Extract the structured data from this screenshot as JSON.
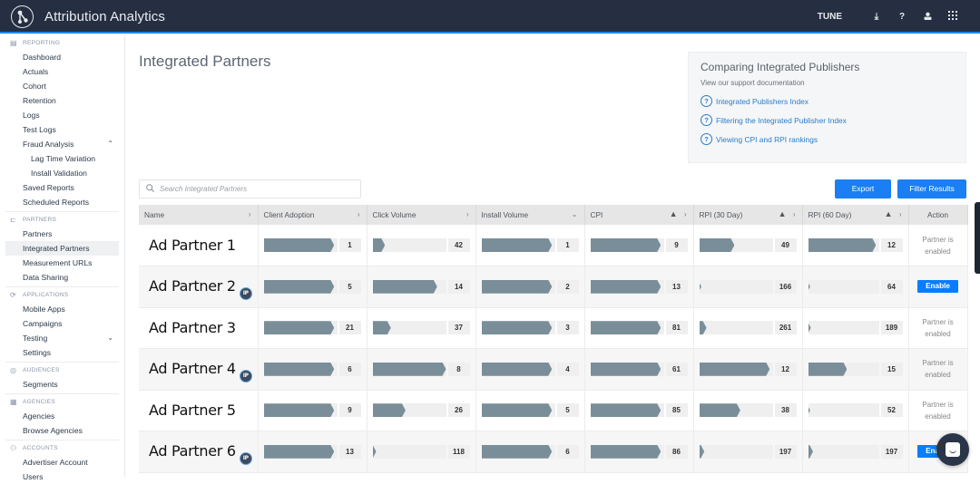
{
  "header": {
    "app_title": "Attribution Analytics",
    "account_label": "TUNE",
    "icons": [
      "download-icon",
      "help-icon",
      "user-icon",
      "apps-grid-icon"
    ]
  },
  "sidebar": {
    "sections": [
      {
        "label": "REPORTING",
        "icon": "bar-chart-icon",
        "items": [
          {
            "label": "Dashboard"
          },
          {
            "label": "Actuals"
          },
          {
            "label": "Cohort"
          },
          {
            "label": "Retention"
          },
          {
            "label": "Logs"
          },
          {
            "label": "Test Logs"
          },
          {
            "label": "Fraud Analysis",
            "expanded": true
          },
          {
            "label": "Lag Time Variation",
            "sub": true
          },
          {
            "label": "Install Validation",
            "sub": true
          },
          {
            "label": "Saved Reports"
          },
          {
            "label": "Scheduled Reports"
          }
        ]
      },
      {
        "label": "PARTNERS",
        "icon": "partners-icon",
        "items": [
          {
            "label": "Partners"
          },
          {
            "label": "Integrated Partners",
            "active": true
          },
          {
            "label": "Measurement URLs"
          },
          {
            "label": "Data Sharing"
          }
        ]
      },
      {
        "label": "APPLICATIONS",
        "icon": "applications-icon",
        "items": [
          {
            "label": "Mobile Apps"
          },
          {
            "label": "Campaigns"
          },
          {
            "label": "Testing",
            "collapsed": true
          },
          {
            "label": "Settings"
          }
        ]
      },
      {
        "label": "AUDIENCES",
        "icon": "audiences-icon",
        "items": [
          {
            "label": "Segments"
          }
        ]
      },
      {
        "label": "AGENCIES",
        "icon": "agencies-icon",
        "items": [
          {
            "label": "Agencies"
          },
          {
            "label": "Browse Agencies"
          }
        ]
      },
      {
        "label": "ACCOUNTS",
        "icon": "accounts-icon",
        "items": [
          {
            "label": "Advertiser Account"
          },
          {
            "label": "Users"
          }
        ]
      }
    ]
  },
  "main": {
    "page_title": "Integrated Partners",
    "help": {
      "title": "Comparing Integrated Publishers",
      "subtitle": "View our support documentation",
      "links": [
        "Integrated Publishers Index",
        "Filtering the Integrated Publisher Index",
        "Viewing CPI and RPI rankings"
      ]
    },
    "search_placeholder": "Search Integrated Partners",
    "export_label": "Export",
    "filter_label": "Filter Results",
    "table": {
      "columns": [
        {
          "label": "Name",
          "sort": "›"
        },
        {
          "label": "Client Adoption",
          "sort": "›"
        },
        {
          "label": "Click Volume",
          "sort": "›"
        },
        {
          "label": "Install Volume",
          "sort": "⌄"
        },
        {
          "label": "CPI",
          "sort": "›",
          "warning": true
        },
        {
          "label": "RPI (30 Day)",
          "sort": "›",
          "warning": true
        },
        {
          "label": "RPI (60 Day)",
          "sort": "›",
          "warning": true
        },
        {
          "label": "Action"
        }
      ],
      "rows": [
        {
          "name": "Ad Partner 1",
          "badge": false,
          "metrics": [
            {
              "rank": 1,
              "fill": 0.96
            },
            {
              "rank": 42,
              "fill": 0.17
            },
            {
              "rank": 1,
              "fill": 0.96
            },
            {
              "rank": 9,
              "fill": 0.96
            },
            {
              "rank": 49,
              "fill": 0.48
            },
            {
              "rank": 12,
              "fill": 0.96
            }
          ],
          "action": {
            "type": "text",
            "text": "Partner is enabled"
          }
        },
        {
          "name": "Ad Partner 2",
          "badge": true,
          "badge_label": "IP",
          "metrics": [
            {
              "rank": 5,
              "fill": 0.96
            },
            {
              "rank": 14,
              "fill": 0.88
            },
            {
              "rank": 2,
              "fill": 0.96
            },
            {
              "rank": 13,
              "fill": 0.96
            },
            {
              "rank": 166,
              "fill": 0.02
            },
            {
              "rank": 64,
              "fill": 0.02
            }
          ],
          "action": {
            "type": "button",
            "text": "Enable"
          }
        },
        {
          "name": "Ad Partner 3",
          "badge": false,
          "metrics": [
            {
              "rank": 21,
              "fill": 0.96
            },
            {
              "rank": 37,
              "fill": 0.25
            },
            {
              "rank": 3,
              "fill": 0.96
            },
            {
              "rank": 81,
              "fill": 0.96
            },
            {
              "rank": 261,
              "fill": 0.1
            },
            {
              "rank": 189,
              "fill": 0.04
            }
          ],
          "action": {
            "type": "text",
            "text": "Partner is enabled"
          }
        },
        {
          "name": "Ad Partner 4",
          "badge": true,
          "badge_label": "IP",
          "metrics": [
            {
              "rank": 6,
              "fill": 0.96
            },
            {
              "rank": 8,
              "fill": 1.0
            },
            {
              "rank": 4,
              "fill": 0.96
            },
            {
              "rank": 61,
              "fill": 0.96
            },
            {
              "rank": 12,
              "fill": 0.96
            },
            {
              "rank": 15,
              "fill": 0.55
            }
          ],
          "action": {
            "type": "text",
            "text": "Partner is enabled"
          }
        },
        {
          "name": "Ad Partner 5",
          "badge": false,
          "metrics": [
            {
              "rank": 9,
              "fill": 0.96
            },
            {
              "rank": 26,
              "fill": 0.45
            },
            {
              "rank": 5,
              "fill": 0.96
            },
            {
              "rank": 85,
              "fill": 0.96
            },
            {
              "rank": 38,
              "fill": 0.56
            },
            {
              "rank": 52,
              "fill": 0.01
            }
          ],
          "action": {
            "type": "text",
            "text": "Partner is enabled"
          }
        },
        {
          "name": "Ad Partner 6",
          "badge": true,
          "badge_label": "IP",
          "metrics": [
            {
              "rank": 13,
              "fill": 0.96
            },
            {
              "rank": 118,
              "fill": 0.05
            },
            {
              "rank": 6,
              "fill": 0.96
            },
            {
              "rank": 86,
              "fill": 0.96
            },
            {
              "rank": 197,
              "fill": 0.07
            },
            {
              "rank": 197,
              "fill": 0.07
            }
          ],
          "action": {
            "type": "button",
            "text": "Enable"
          }
        }
      ]
    }
  },
  "colors": {
    "topbar": "#252f41",
    "accent": "#1a7ef4",
    "bar_fill": "#7a8e99",
    "link": "#2a7dc9"
  }
}
